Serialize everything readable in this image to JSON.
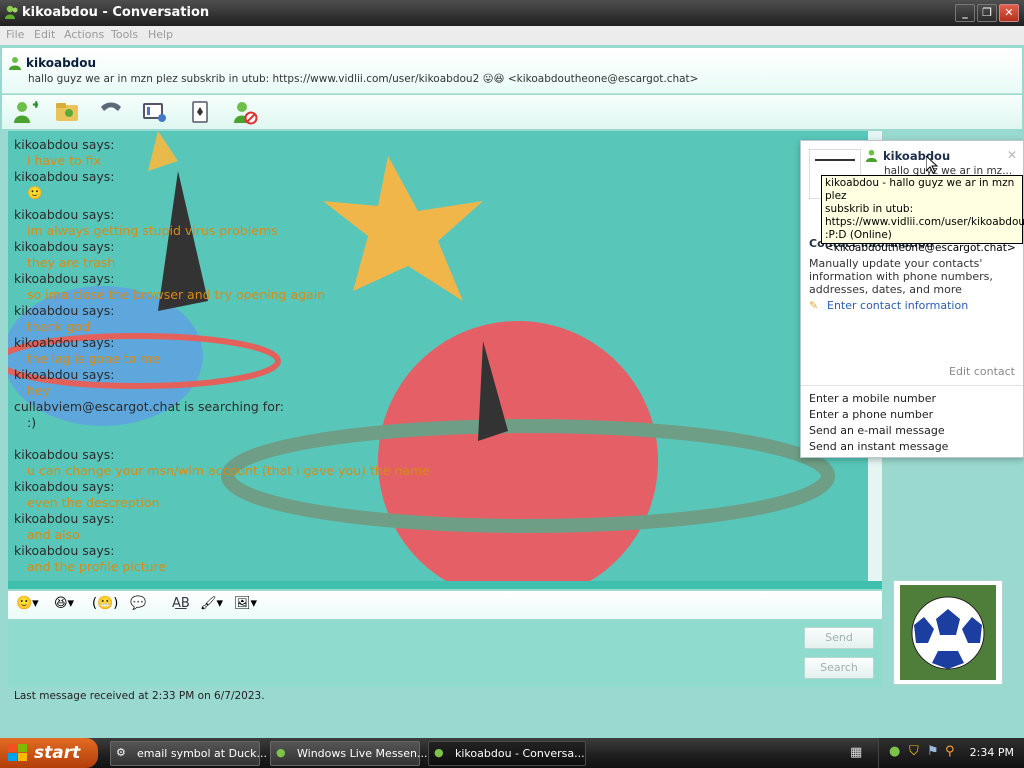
{
  "window": {
    "title": "kikoabdou - Conversation"
  },
  "menu": [
    "File",
    "Edit",
    "Actions",
    "Tools",
    "Help"
  ],
  "contact": {
    "name": "kikoabdou",
    "psm": "hallo guyz we ar in mzn plez subskrib in utub: https://www.vidlii.com/user/kikoabdou2",
    "email": "<kikoabdoutheone@escargot.chat>"
  },
  "toolbar_icons": [
    "invite-contact-icon",
    "share-files-icon",
    "call-icon",
    "video-icon",
    "games-icon",
    "block-icon"
  ],
  "messages": [
    {
      "who": "kikoabdou says:",
      "text": "i have to fix"
    },
    {
      "who": "kikoabdou says:",
      "text": "🙂"
    },
    {
      "who": "kikoabdou says:",
      "text": "im always getting stupid virus problems"
    },
    {
      "who": "kikoabdou says:",
      "text": "they are trash"
    },
    {
      "who": "kikoabdou says:",
      "text": "so ima close the browser and try opening again"
    },
    {
      "who": "kikoabdou says:",
      "text": "thank god"
    },
    {
      "who": "kikoabdou says:",
      "text": "the lag is gone to me"
    },
    {
      "who": "kikoabdou says:",
      "text": "hey"
    },
    {
      "who": "cullabviem@escargot.chat is searching for:",
      "text": ":)"
    },
    {
      "who": "kikoabdou says:",
      "text": "u can change your msn/wlm account (that i gave you) the name"
    },
    {
      "who": "kikoabdou says:",
      "text": "even the descreption"
    },
    {
      "who": "kikoabdou says:",
      "text": "and also"
    },
    {
      "who": "kikoabdou says:",
      "text": "and the profile picture"
    }
  ],
  "buttons": {
    "send": "Send",
    "search": "Search"
  },
  "status_line": "Last message received at 2:33 PM on 6/7/2023.",
  "card": {
    "name": "kikoabdou",
    "psm": "hallo guyz we ar in mz...",
    "heading": "Contact information",
    "desc": "Manually update your contacts' information with phone numbers, addresses, dates, and more",
    "link": "Enter contact information",
    "edit": "Edit contact",
    "actions": [
      "Enter a mobile number",
      "Enter a phone number",
      "Send an e-mail message",
      "Send an instant message"
    ]
  },
  "tooltip": {
    "line1": "kikoabdou - hallo guyz we ar in mzn plez",
    "line2": "subskrib in utub:",
    "line3": "https://www.vidlii.com/user/kikoabdou2",
    "line4": ":P:D (Online)",
    "line5": "<kikoabdoutheone@escargot.chat>"
  },
  "taskbar": {
    "start": "start",
    "tasks": [
      "email symbol at Duck...",
      "Windows Live Messen...",
      "kikoabdou - Conversa..."
    ],
    "clock": "2:34 PM"
  },
  "colors": {
    "message_text": "#d98a14",
    "chat_bg": "#58c7b9",
    "frame": "#9ad9cf"
  }
}
